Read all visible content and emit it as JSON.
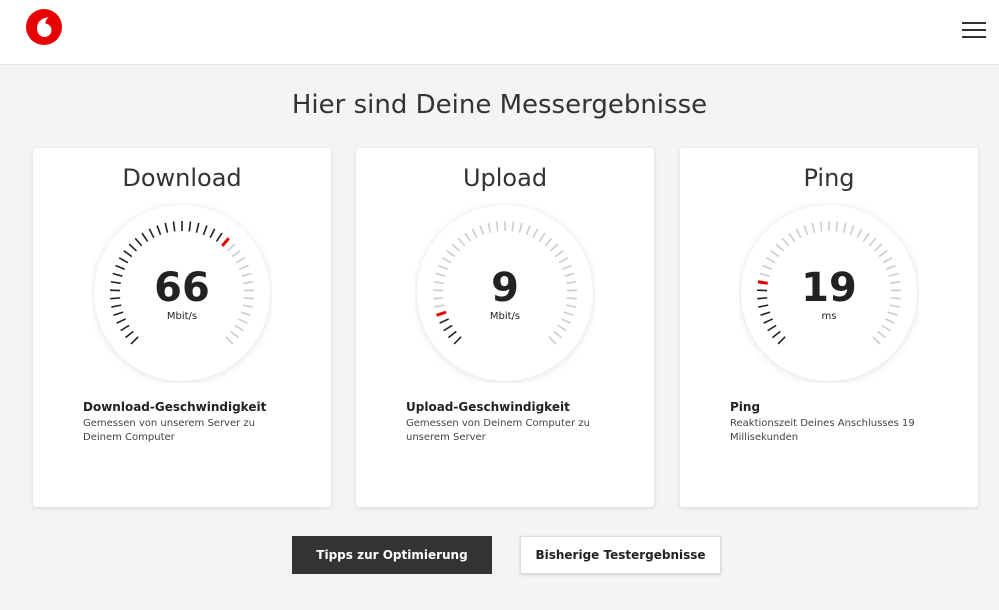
{
  "header": {
    "logo_icon": "vodafone-logo-icon",
    "menu_icon": "hamburger-menu-icon",
    "brand_color": "#e60000"
  },
  "page_title": "Hier sind Deine Messergebnisse",
  "cards": [
    {
      "title": "Download",
      "value": "66",
      "unit": "Mbit/s",
      "gauge_fraction": 0.66,
      "desc_title": "Download-Geschwindigkeit",
      "desc_text": "Gemessen von unserem Server zu Deinem Computer"
    },
    {
      "title": "Upload",
      "value": "9",
      "unit": "Mbit/s",
      "gauge_fraction": 0.09,
      "desc_title": "Upload-Geschwindigkeit",
      "desc_text": "Gemessen von Deinem Computer zu unserem Server"
    },
    {
      "title": "Ping",
      "value": "19",
      "unit": "ms",
      "gauge_fraction": 0.19,
      "desc_title": "Ping",
      "desc_text": "Reaktionszeit Deines Anschlusses 19 Millisekunden"
    }
  ],
  "buttons": {
    "tips": "Tipps zur Optimierung",
    "history": "Bisherige Testergebnisse"
  },
  "colors": {
    "active_tick": "#222222",
    "inactive_tick": "#cccccc",
    "marker": "#e60000"
  }
}
